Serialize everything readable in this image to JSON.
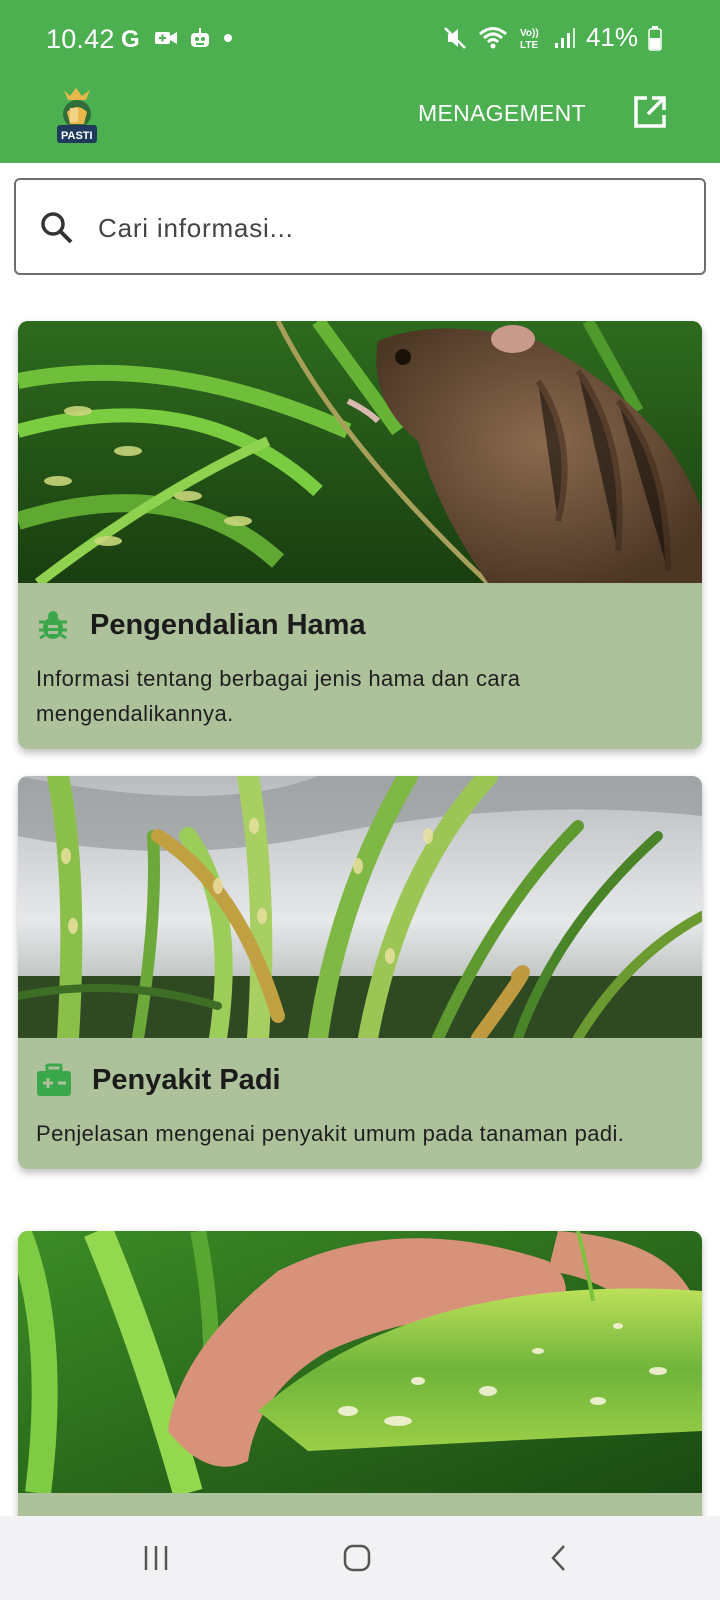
{
  "status_bar": {
    "time": "10.42",
    "left_icons": [
      "google-g-icon",
      "video-call-icon",
      "assistant-bot-icon",
      "notification-dot-icon"
    ],
    "right_icons": [
      "mute-icon",
      "wifi-icon",
      "volte-icon",
      "signal-icon",
      "battery-icon"
    ],
    "volte_label": "Vo)) LTE",
    "battery": "41%"
  },
  "app_bar": {
    "logo_text": "PASTI",
    "menu_label": "MENAGEMENT",
    "accent_color": "#4caf50"
  },
  "search": {
    "placeholder": "Cari informasi..."
  },
  "cards": [
    {
      "icon": "bug-icon",
      "title": "Pengendalian Hama",
      "description": "Informasi tentang berbagai jenis hama dan cara mengendalikannya.",
      "image": "rat-on-rice-plant-photo"
    },
    {
      "icon": "medical-bag-icon",
      "title": "Penyakit Padi",
      "description": "Penjelasan mengenai penyakit umum pada tanaman padi.",
      "image": "diseased-rice-leaves-photo"
    },
    {
      "icon": "",
      "title": "",
      "description": "",
      "image": "hand-holding-spotted-leaf-photo"
    }
  ],
  "card_color": "#adc29b",
  "nav_bar": {
    "buttons": [
      "recent-apps-icon",
      "home-icon",
      "back-icon"
    ]
  }
}
